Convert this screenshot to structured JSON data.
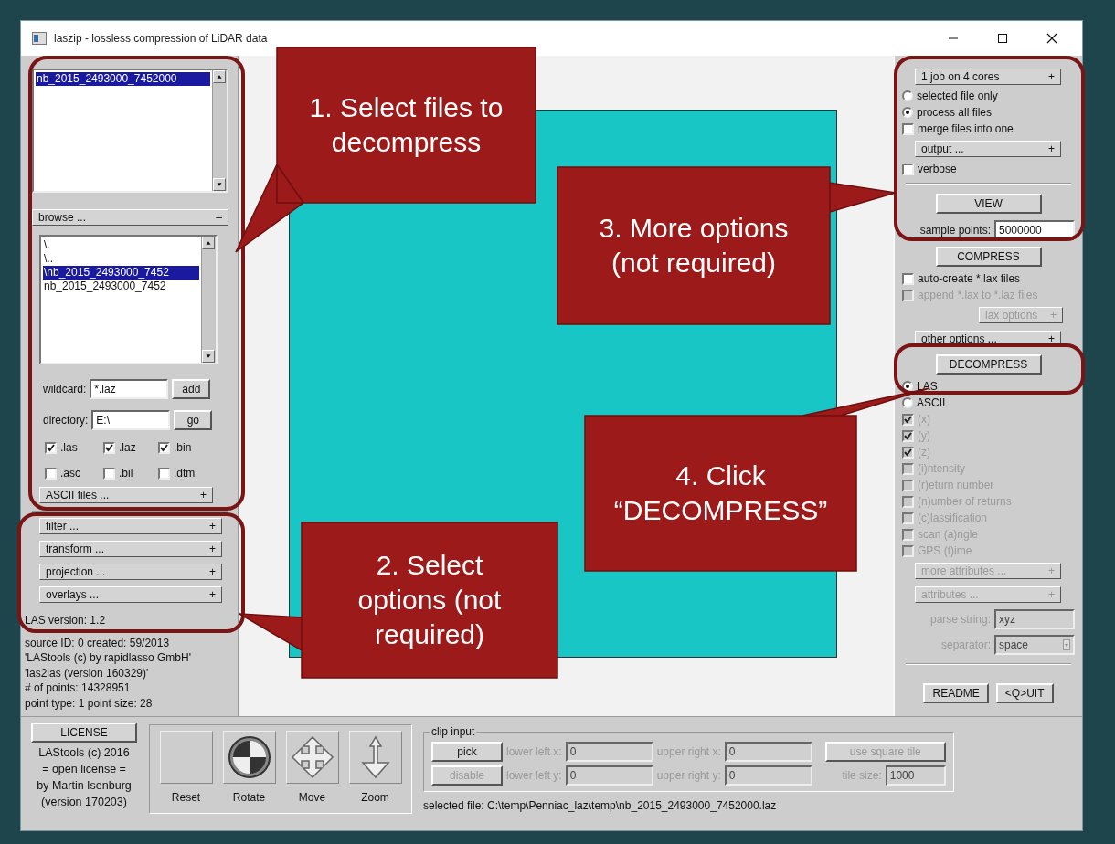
{
  "window": {
    "title": "laszip - lossless compression of LiDAR data"
  },
  "left_panel": {
    "file_list": [
      {
        "text": "nb_2015_2493000_7452000",
        "selected": true
      }
    ],
    "browse": {
      "label": "browse ...",
      "toggle": "–"
    },
    "directory_list": [
      {
        "text": "\\.",
        "selected": false
      },
      {
        "text": "\\..",
        "selected": false
      },
      {
        "text": "\\nb_2015_2493000_7452",
        "selected": true
      },
      {
        "text": "nb_2015_2493000_7452",
        "selected": false
      }
    ],
    "wildcard": {
      "label": "wildcard:",
      "value": "*.laz",
      "button": "add"
    },
    "directory": {
      "label": "directory:",
      "value": "E:\\",
      "button": "go"
    },
    "extensions": [
      {
        "label": ".las",
        "checked": true
      },
      {
        "label": ".laz",
        "checked": true
      },
      {
        "label": ".bin",
        "checked": true
      },
      {
        "label": ".asc",
        "checked": false
      },
      {
        "label": ".bil",
        "checked": false
      },
      {
        "label": ".dtm",
        "checked": false
      }
    ],
    "ascii_files": {
      "label": "ASCII files ...",
      "toggle": "+"
    },
    "sections": [
      {
        "label": "filter ...",
        "toggle": "+"
      },
      {
        "label": "transform ...",
        "toggle": "+"
      },
      {
        "label": "projection ...",
        "toggle": "+"
      },
      {
        "label": "overlays ...",
        "toggle": "+"
      }
    ],
    "info_lines": [
      "LAS version: 1.2",
      "source ID: 0 created: 59/2013",
      "'LAStools (c) by rapidlasso GmbH'",
      "'las2las (version 160329)'",
      "# of points: 14328951",
      "point type: 1 point size: 28"
    ]
  },
  "right_panel": {
    "items": [
      {
        "kind": "dropdown",
        "label": "1 job on 4 cores",
        "toggle": "+",
        "disabled": false
      },
      {
        "kind": "radio",
        "label": "selected file only",
        "selected": false,
        "disabled": false
      },
      {
        "kind": "radio",
        "label": "process all files",
        "selected": true,
        "disabled": false
      },
      {
        "kind": "checkbox",
        "label": "merge files into one",
        "checked": false,
        "disabled": false
      },
      {
        "kind": "section",
        "label": "output ...",
        "toggle": "+",
        "disabled": false
      },
      {
        "kind": "checkbox",
        "label": "verbose",
        "checked": false,
        "disabled": false
      },
      {
        "kind": "rule"
      },
      {
        "kind": "button",
        "label": "VIEW",
        "disabled": false
      },
      {
        "kind": "field",
        "label": "sample points:",
        "value": "5000000",
        "disabled": false
      },
      {
        "kind": "button",
        "label": "COMPRESS",
        "disabled": false
      },
      {
        "kind": "checkbox",
        "label": "auto-create *.lax files",
        "checked": false,
        "disabled": false
      },
      {
        "kind": "checkbox",
        "label": "append *.lax to *.laz files",
        "checked": false,
        "disabled": true
      },
      {
        "kind": "subsection",
        "label": "lax options",
        "toggle": "+",
        "disabled": true
      },
      {
        "kind": "section",
        "label": "other options ...",
        "toggle": "+",
        "disabled": false
      },
      {
        "kind": "button",
        "label": "DECOMPRESS",
        "disabled": false
      },
      {
        "kind": "radio",
        "label": "LAS",
        "selected": true,
        "disabled": false
      },
      {
        "kind": "radio",
        "label": "ASCII",
        "selected": false,
        "disabled": false
      },
      {
        "kind": "checkbox",
        "label": "(x)",
        "checked": true,
        "disabled": true
      },
      {
        "kind": "checkbox",
        "label": "(y)",
        "checked": true,
        "disabled": true
      },
      {
        "kind": "checkbox",
        "label": "(z)",
        "checked": true,
        "disabled": true
      },
      {
        "kind": "checkbox",
        "label": "(i)ntensity",
        "checked": false,
        "disabled": true
      },
      {
        "kind": "checkbox",
        "label": "(r)eturn number",
        "checked": false,
        "disabled": true
      },
      {
        "kind": "checkbox",
        "label": "(n)umber of returns",
        "checked": false,
        "disabled": true
      },
      {
        "kind": "checkbox",
        "label": "(c)lassification",
        "checked": false,
        "disabled": true
      },
      {
        "kind": "checkbox",
        "label": "scan (a)ngle",
        "checked": false,
        "disabled": true
      },
      {
        "kind": "checkbox",
        "label": "GPS (t)ime",
        "checked": false,
        "disabled": true
      },
      {
        "kind": "section",
        "label": "more attributes ...",
        "toggle": "+",
        "disabled": true
      },
      {
        "kind": "section",
        "label": "attributes ...",
        "toggle": "+",
        "disabled": true
      },
      {
        "kind": "field",
        "label": "parse string:",
        "value": "xyz",
        "disabled": true
      },
      {
        "kind": "select",
        "label": "separator:",
        "value": "space",
        "disabled": true
      },
      {
        "kind": "rule"
      },
      {
        "kind": "buttons",
        "buttons": [
          "README",
          "<Q>UIT"
        ]
      }
    ]
  },
  "bottom_bar": {
    "license": {
      "button": "LICENSE",
      "lines": [
        "LAStools (c) 2016",
        "= open license =",
        "by Martin Isenburg",
        "(version 170203)"
      ]
    },
    "tools": [
      {
        "kind": "reset",
        "label": "Reset"
      },
      {
        "kind": "rotate",
        "label": "Rotate"
      },
      {
        "kind": "move",
        "label": "Move"
      },
      {
        "kind": "zoom",
        "label": "Zoom"
      }
    ],
    "clip_input": {
      "title": "clip input",
      "buttons": [
        {
          "label": "pick",
          "disabled": false
        },
        {
          "label": "disable",
          "disabled": true
        }
      ],
      "fields": [
        {
          "label": "lower left x:",
          "value": "0",
          "disabled": true
        },
        {
          "label": "upper right x:",
          "value": "0",
          "disabled": true
        },
        {
          "label": "lower left y:",
          "value": "0",
          "disabled": true
        },
        {
          "label": "upper right y:",
          "value": "0",
          "disabled": true
        }
      ],
      "square_tile": {
        "label": "use square tile",
        "disabled": true
      },
      "tile_size": {
        "label": "tile size:",
        "value": "1000",
        "disabled": true
      }
    },
    "selected_file": "selected file: C:\\temp\\Penniac_laz\\temp\\nb_2015_2493000_7452000.laz"
  },
  "callouts": [
    {
      "text": "1. Select files to\ndecompress"
    },
    {
      "text": "2. Select\noptions (not\nrequired)"
    },
    {
      "text": "3. More options\n(not required)"
    },
    {
      "text": "4. Click\n“DECOMPRESS”"
    }
  ]
}
